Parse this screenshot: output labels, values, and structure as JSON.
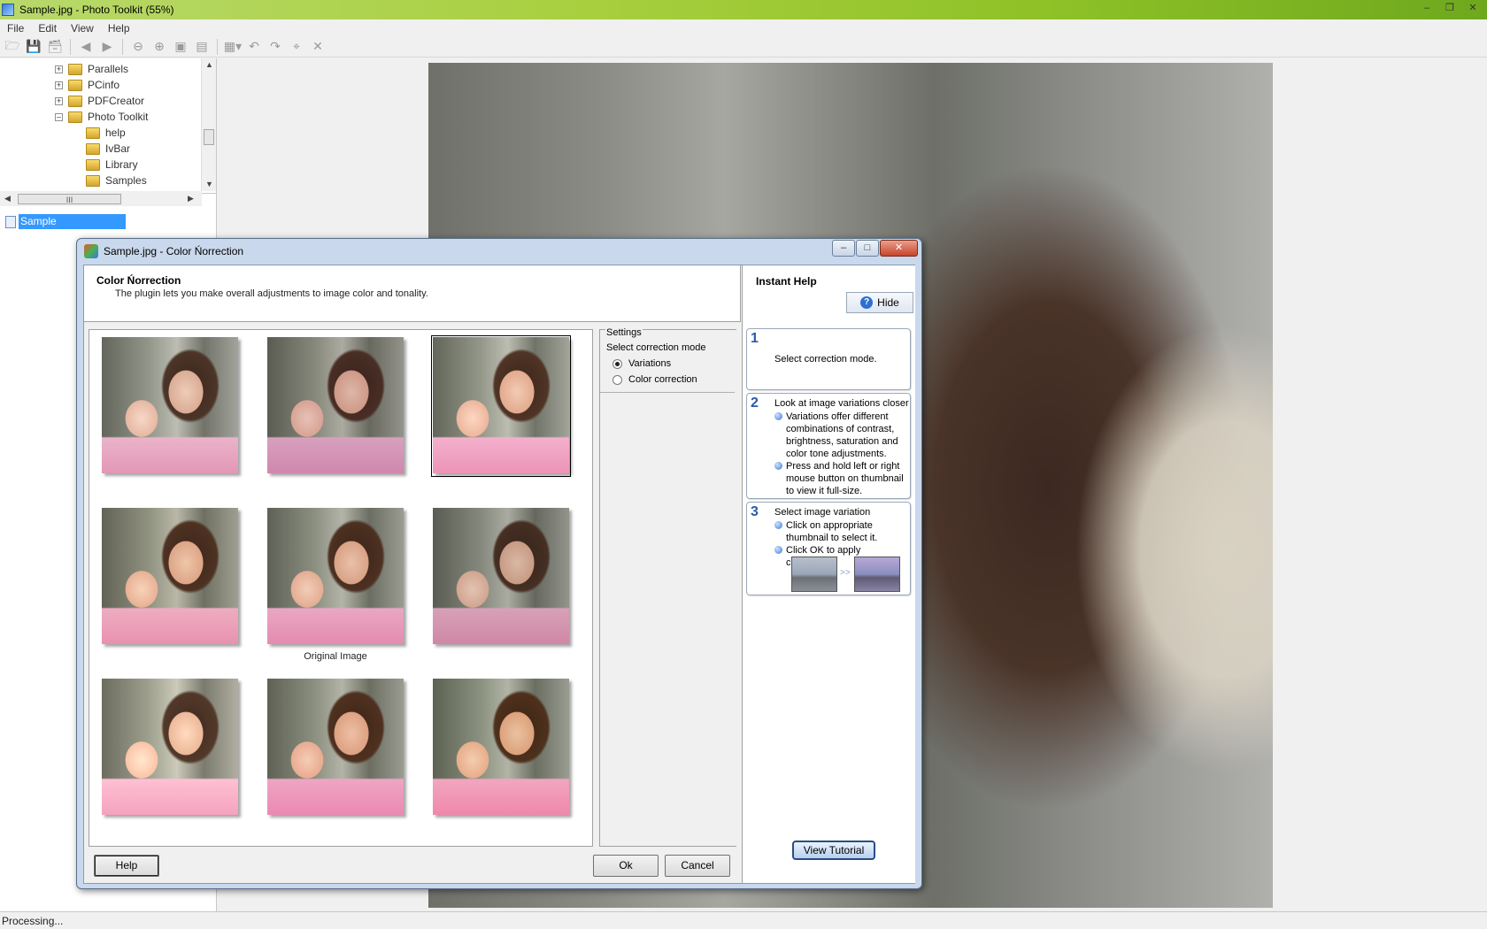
{
  "window": {
    "title": "Sample.jpg - Photo Toolkit (55%)",
    "minimize": "–",
    "restore": "❐",
    "close": "✕"
  },
  "menu": [
    "File",
    "Edit",
    "View",
    "Help"
  ],
  "toolbar_icons": [
    "open-icon",
    "save-icon",
    "save-all-icon",
    "back-icon",
    "forward-icon",
    "zoom-out-icon",
    "zoom-in-icon",
    "fit-icon",
    "actual-size-icon",
    "view-mode-icon",
    "rotate-left-icon",
    "rotate-right-icon",
    "crop-icon",
    "delete-icon"
  ],
  "tree": {
    "items": [
      "Parallels",
      "PCinfo",
      "PDFCreator",
      "Photo Toolkit",
      "help",
      "IvBar",
      "Library",
      "Samples"
    ],
    "hscroll_label": "III"
  },
  "album": {
    "selected": "Sample"
  },
  "status": {
    "text": "Processing..."
  },
  "dialog": {
    "title": "Sample.jpg - Color Ńorrection",
    "heading": "Color Ńorrection",
    "description": "The plugin lets you make overall adjustments to image color and tonality.",
    "original_caption": "Original Image",
    "settings": {
      "legend": "Settings",
      "mode_label": "Select correction mode",
      "options": [
        "Variations",
        "Color correction"
      ],
      "selected": "Variations"
    },
    "help": {
      "title": "Instant Help",
      "hide_label": "Hide",
      "step1": {
        "num": "1",
        "text": "Select correction mode."
      },
      "step2": {
        "num": "2",
        "heading": "Look at image variations closer",
        "bullets": [
          "Variations offer different combinations of contrast, brightness, saturation and color tone adjustments.",
          "Press and hold left or right mouse button on thumbnail to view it full-size."
        ]
      },
      "step3": {
        "num": "3",
        "heading": "Select image variation",
        "bullets": [
          "Click on appropriate thumbnail to select it.",
          "Click OK to apply correction."
        ],
        "arrow": ">>"
      },
      "tutorial_label": "View Tutorial"
    },
    "buttons": {
      "help": "Help",
      "ok": "Ok",
      "cancel": "Cancel"
    }
  }
}
